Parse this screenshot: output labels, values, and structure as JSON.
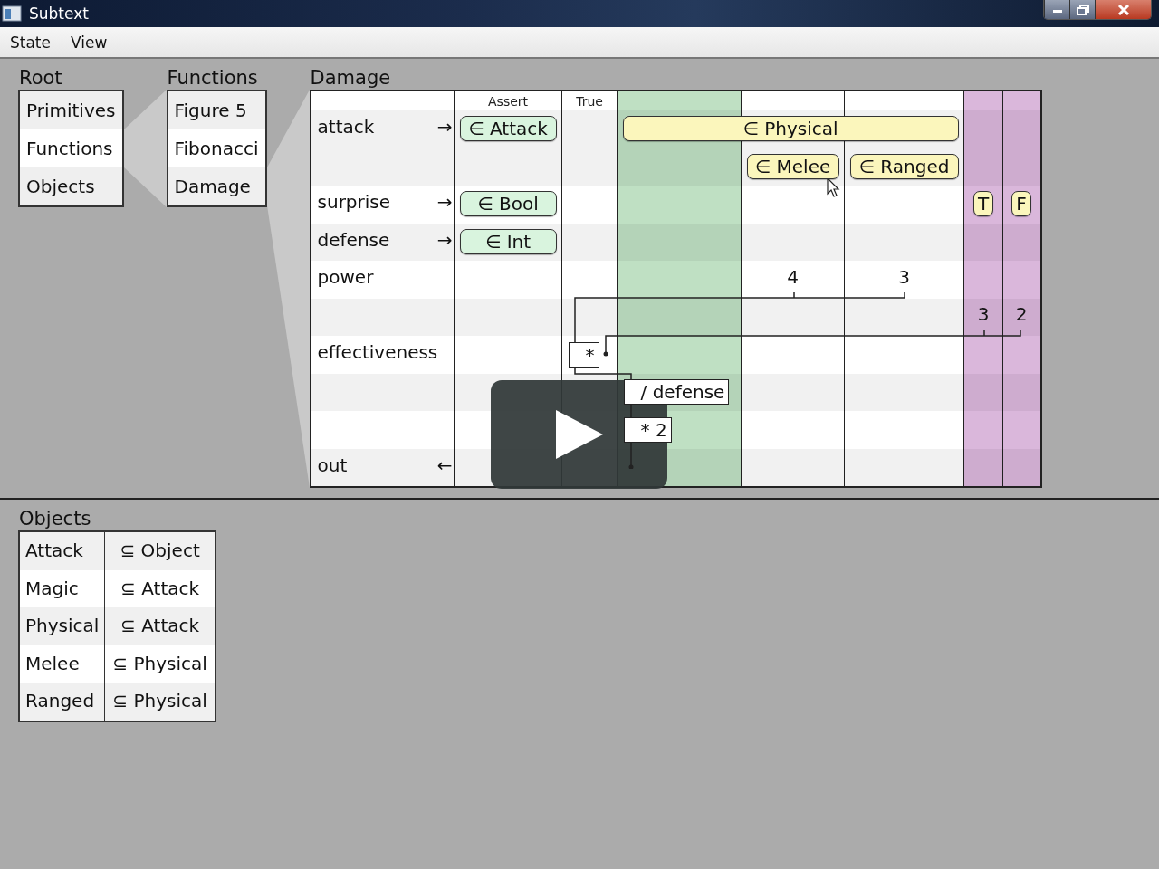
{
  "window": {
    "title": "Subtext"
  },
  "menu": [
    {
      "label": "State"
    },
    {
      "label": "View"
    }
  ],
  "panels": [
    {
      "title": "Root",
      "items": [
        {
          "label": "Primitives",
          "selected": false
        },
        {
          "label": "Functions",
          "selected": true
        },
        {
          "label": "Objects",
          "selected": false
        }
      ]
    },
    {
      "title": "Functions",
      "items": [
        {
          "label": "Figure 5",
          "selected": false
        },
        {
          "label": "Fibonacci",
          "selected": false
        },
        {
          "label": "Damage",
          "selected": true
        }
      ]
    }
  ],
  "damage": {
    "title": "Damage",
    "columns": [
      {
        "kind": "plain",
        "header": "Assert"
      },
      {
        "kind": "plain",
        "header": "True"
      },
      {
        "kind": "green"
      },
      {
        "kind": "plain"
      },
      {
        "kind": "plain"
      },
      {
        "kind": "purple"
      },
      {
        "kind": "purple"
      }
    ],
    "rows": [
      {
        "label": "attack",
        "arrow": "→",
        "cells": [
          {
            "text": "∈ Attack",
            "kind": "assert"
          },
          {},
          {},
          {
            "text": "∈ Physical",
            "kind": "case-wide"
          },
          {},
          {},
          {}
        ]
      },
      {
        "cells": [
          {},
          {},
          {},
          {
            "text": "∈ Melee",
            "kind": "case"
          },
          {
            "text": "∈ Ranged",
            "kind": "case"
          },
          {},
          {}
        ]
      },
      {
        "label": "surprise",
        "arrow": "→",
        "cells": [
          {
            "text": "∈ Bool",
            "kind": "assert"
          },
          {},
          {},
          {},
          {},
          {
            "text": "T",
            "kind": "case"
          },
          {
            "text": "F",
            "kind": "case"
          }
        ]
      },
      {
        "label": "defense",
        "arrow": "→",
        "cells": [
          {
            "text": "∈ Int",
            "kind": "assert"
          },
          {},
          {},
          {},
          {},
          {},
          {}
        ]
      },
      {
        "label": "power",
        "cells": [
          {},
          {},
          {},
          {
            "text": "4",
            "kind": "value"
          },
          {
            "text": "3",
            "kind": "value"
          },
          {},
          {}
        ]
      },
      {
        "cells": [
          {},
          {},
          {},
          {},
          {},
          {
            "text": "3",
            "kind": "value"
          },
          {
            "text": "2",
            "kind": "value"
          }
        ]
      },
      {
        "label": "effectiveness",
        "cells": [
          {},
          {
            "text": "*",
            "kind": "op"
          },
          {},
          {},
          {},
          {},
          {}
        ]
      },
      {
        "cells": [
          {},
          {},
          {
            "text": "/ defense",
            "kind": "op"
          },
          {},
          {},
          {},
          {}
        ]
      },
      {
        "cells": [
          {},
          {},
          {
            "text": "* 2",
            "kind": "op"
          },
          {},
          {},
          {},
          {}
        ]
      },
      {
        "label": "out",
        "arrow": "←",
        "cells": [
          {},
          {},
          {},
          {},
          {},
          {},
          {}
        ]
      }
    ]
  },
  "objects": {
    "title": "Objects",
    "rows": [
      {
        "name": "Attack",
        "parent": "⊆ Object"
      },
      {
        "name": "Magic",
        "parent": "⊆ Attack"
      },
      {
        "name": "Physical",
        "parent": "⊆ Attack"
      },
      {
        "name": "Melee",
        "parent": "⊆ Physical"
      },
      {
        "name": "Ranged",
        "parent": "⊆ Physical"
      }
    ]
  }
}
